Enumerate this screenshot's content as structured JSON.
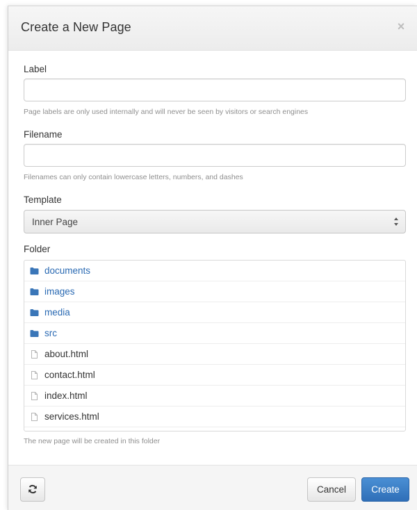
{
  "dialog": {
    "title": "Create a New Page",
    "close_icon": "close-icon",
    "close_glyph": "×"
  },
  "form": {
    "label": {
      "label": "Label",
      "value": "",
      "help": "Page labels are only used internally and will never be seen by visitors or search engines"
    },
    "filename": {
      "label": "Filename",
      "value": "",
      "help": "Filenames can only contain lowercase letters, numbers, and dashes"
    },
    "template": {
      "label": "Template",
      "selected": "Inner Page"
    },
    "folder": {
      "label": "Folder",
      "help": "The new page will be created in this folder",
      "items": [
        {
          "name": "documents",
          "type": "folder",
          "icon": "folder-icon"
        },
        {
          "name": "images",
          "type": "folder",
          "icon": "folder-icon"
        },
        {
          "name": "media",
          "type": "folder",
          "icon": "folder-icon"
        },
        {
          "name": "src",
          "type": "folder",
          "icon": "folder-icon"
        },
        {
          "name": "about.html",
          "type": "file",
          "icon": "file-icon"
        },
        {
          "name": "contact.html",
          "type": "file",
          "icon": "file-icon"
        },
        {
          "name": "index.html",
          "type": "file",
          "icon": "file-icon"
        },
        {
          "name": "services.html",
          "type": "file",
          "icon": "file-icon"
        }
      ]
    }
  },
  "footer": {
    "refresh_icon": "refresh-icon",
    "cancel_label": "Cancel",
    "create_label": "Create"
  },
  "colors": {
    "primary": "#337ab7",
    "link": "#2a6ab3",
    "folder_icon": "#3a76b8",
    "help_text": "#8f8f8f"
  }
}
